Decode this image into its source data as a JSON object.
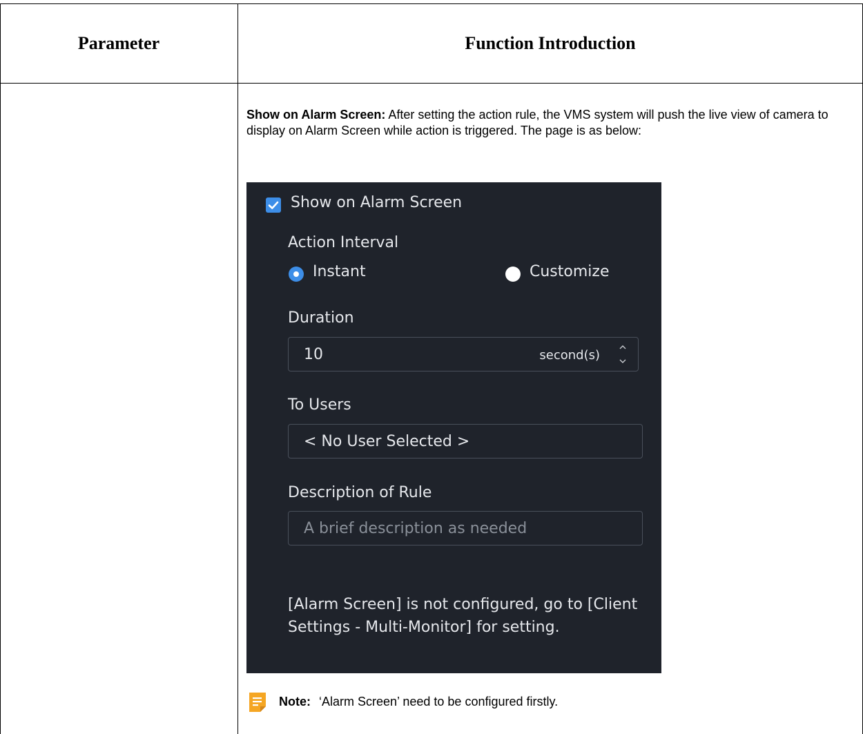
{
  "table": {
    "headers": {
      "parameter": "Parameter",
      "function": "Function Introduction"
    }
  },
  "intro": {
    "lead": "Show on Alarm Screen:",
    "text": " After setting the action rule, the VMS system will push the live view of camera to display on Alarm Screen while action is triggered. The page is as below:"
  },
  "panel": {
    "checkbox_label": "Show on Alarm Screen",
    "action_interval_label": "Action Interval",
    "radio_instant": "Instant",
    "radio_customize": "Customize",
    "selected_interval": "Instant",
    "duration_label": "Duration",
    "duration_value": "10",
    "duration_unit": "second(s)",
    "to_users_label": "To Users",
    "to_users_value": "< No User Selected >",
    "description_label": "Description of Rule",
    "description_placeholder": "A brief description as needed",
    "config_message": "[Alarm Screen] is not configured, go to [Client Settings - Multi-Monitor] for setting."
  },
  "note": {
    "label": "Note:",
    "text": "‘Alarm Screen’ need to be configured firstly."
  },
  "colors": {
    "panel_background": "#1f232b",
    "accent": "#3d8ee8",
    "note_icon": "#f5a623"
  }
}
